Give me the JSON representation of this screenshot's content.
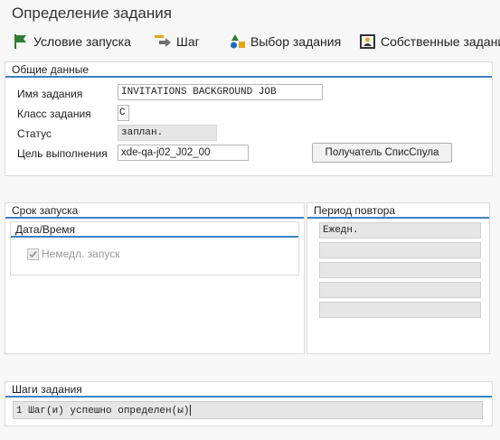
{
  "window": {
    "title": "Определение задания"
  },
  "toolbar": {
    "start_condition": "Условие запуска",
    "step": "Шаг",
    "job_selection": "Выбор задания",
    "own_jobs": "Собственные задания"
  },
  "general": {
    "header": "Общие данные",
    "job_name_label": "Имя задания",
    "job_name_value": "INVITATIONS BACKGROUND JOB",
    "job_class_label": "Класс задания",
    "job_class_value": "C",
    "status_label": "Статус",
    "status_value": "заплан.",
    "exec_target_label": "Цель выполнения",
    "exec_target_value": "xde-qa-j02_J02_00",
    "spool_button": "Получатель СписСпула"
  },
  "start_date": {
    "header": "Срок запуска",
    "subheader": "Дата/Время",
    "immediate_label": "Немедл. запуск",
    "immediate_checked": true
  },
  "repeat_period": {
    "header": "Период повтора",
    "rows": [
      "Ежедн.",
      "",
      "",
      "",
      ""
    ]
  },
  "steps": {
    "header": "Шаги задания",
    "message": "1 Шаг(и) успешно определен(ы)"
  }
}
